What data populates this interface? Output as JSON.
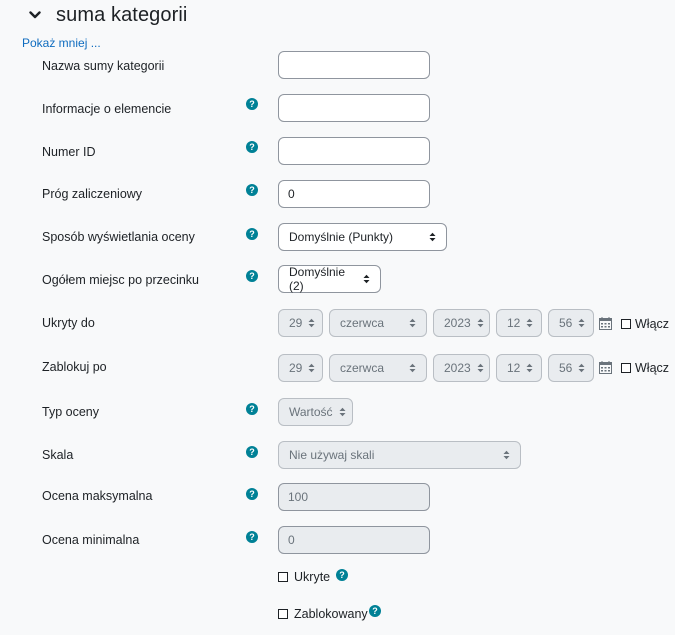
{
  "section": {
    "title": "suma kategorii",
    "toggle_icon": "chevron-down-icon"
  },
  "show_less_link": "Pokaż mniej ...",
  "fields": {
    "name": {
      "label": "Nazwa sumy kategorii",
      "value": ""
    },
    "info": {
      "label": "Informacje o elemencie",
      "value": ""
    },
    "idnumber": {
      "label": "Numer ID",
      "value": ""
    },
    "gradepass": {
      "label": "Próg zaliczeniowy",
      "value": "0"
    },
    "display": {
      "label": "Sposób wyświetlania oceny",
      "value": "Domyślnie (Punkty)"
    },
    "decimals": {
      "label": "Ogółem miejsc po przecinku",
      "value": "Domyślnie (2)"
    },
    "hidden_until": {
      "label": "Ukryty do",
      "day": "29",
      "month": "czerwca",
      "year": "2023",
      "hour": "12",
      "minute": "56",
      "enable_label": "Włącz",
      "enabled": false
    },
    "locked_after": {
      "label": "Zablokuj po",
      "day": "29",
      "month": "czerwca",
      "year": "2023",
      "hour": "12",
      "minute": "56",
      "enable_label": "Włącz",
      "enabled": false
    },
    "gradetype": {
      "label": "Typ oceny",
      "value": "Wartość"
    },
    "scale": {
      "label": "Skala",
      "value": "Nie używaj skali"
    },
    "grademax": {
      "label": "Ocena maksymalna",
      "value": "100"
    },
    "grademin": {
      "label": "Ocena minimalna",
      "value": "0"
    },
    "hidden": {
      "label": "Ukryte",
      "checked": false
    },
    "locked": {
      "label": "Zablokowany",
      "checked": false
    }
  },
  "colors": {
    "link": "#0f6cbf",
    "help": "#008196",
    "disabled_bg": "#e9ecef"
  }
}
